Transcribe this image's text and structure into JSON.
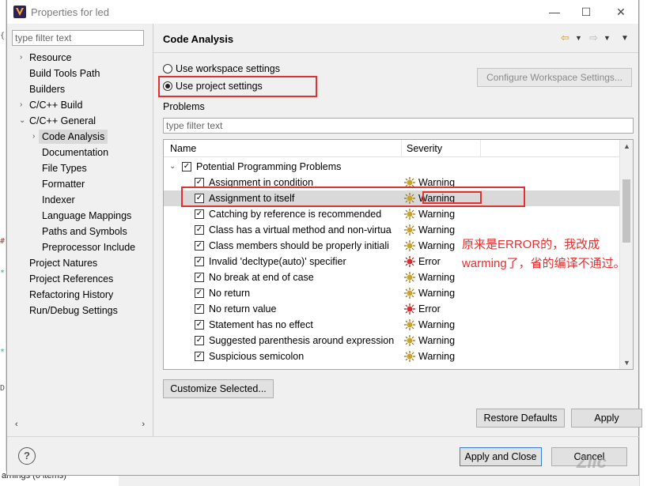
{
  "window": {
    "title": "Properties for led"
  },
  "left": {
    "filter_placeholder": "type filter text",
    "tree": [
      {
        "label": "Resource",
        "expander": "›"
      },
      {
        "label": "Build Tools Path",
        "expander": ""
      },
      {
        "label": "Builders",
        "expander": ""
      },
      {
        "label": "C/C++ Build",
        "expander": "›"
      },
      {
        "label": "C/C++ General",
        "expander": "⌄"
      },
      {
        "label": "Code Analysis",
        "expander": "›"
      },
      {
        "label": "Documentation",
        "expander": ""
      },
      {
        "label": "File Types",
        "expander": ""
      },
      {
        "label": "Formatter",
        "expander": ""
      },
      {
        "label": "Indexer",
        "expander": ""
      },
      {
        "label": "Language Mappings",
        "expander": ""
      },
      {
        "label": "Paths and Symbols",
        "expander": ""
      },
      {
        "label": "Preprocessor Include",
        "expander": ""
      },
      {
        "label": "Project Natures",
        "expander": ""
      },
      {
        "label": "Project References",
        "expander": ""
      },
      {
        "label": "Refactoring History",
        "expander": ""
      },
      {
        "label": "Run/Debug Settings",
        "expander": ""
      }
    ]
  },
  "page": {
    "title": "Code Analysis",
    "radio_workspace": "Use workspace settings",
    "radio_project": "Use project settings",
    "configure_button": "Configure Workspace Settings...",
    "problems_label": "Problems",
    "problems_filter_placeholder": "type filter text",
    "columns": {
      "name": "Name",
      "severity": "Severity"
    },
    "group": "Potential Programming Problems",
    "rows": [
      {
        "name": "Assignment in condition",
        "severity": "Warning"
      },
      {
        "name": "Assignment to itself",
        "severity": "Warning"
      },
      {
        "name": "Catching by reference is recommended",
        "severity": "Warning"
      },
      {
        "name": "Class has a virtual method and non-virtua",
        "severity": "Warning"
      },
      {
        "name": "Class members should be properly initiali",
        "severity": "Warning"
      },
      {
        "name": "Invalid 'decltype(auto)' specifier",
        "severity": "Error"
      },
      {
        "name": "No break at end of case",
        "severity": "Warning"
      },
      {
        "name": "No return",
        "severity": "Warning"
      },
      {
        "name": "No return value",
        "severity": "Error"
      },
      {
        "name": "Statement has no effect",
        "severity": "Warning"
      },
      {
        "name": "Suggested parenthesis around expression",
        "severity": "Warning"
      },
      {
        "name": "Suspicious semicolon",
        "severity": "Warning"
      }
    ],
    "annotation_line1": "原来是ERROR的，我改成",
    "annotation_line2": "warming了，省的编译不通过。",
    "customize_button": "Customize Selected...",
    "restore_button": "Restore Defaults",
    "apply_button": "Apply"
  },
  "footer": {
    "apply_close_button": "Apply and Close",
    "cancel_button": "Cancel",
    "help_glyph": "?",
    "watermark": "Zlic"
  },
  "background": {
    "status_text": "arnings (6 items)"
  },
  "colors": {
    "annotation_red": "#e03030",
    "warning_icon": "#c9a227",
    "error_icon": "#d03030",
    "selected_row": "#d9d9d9"
  }
}
